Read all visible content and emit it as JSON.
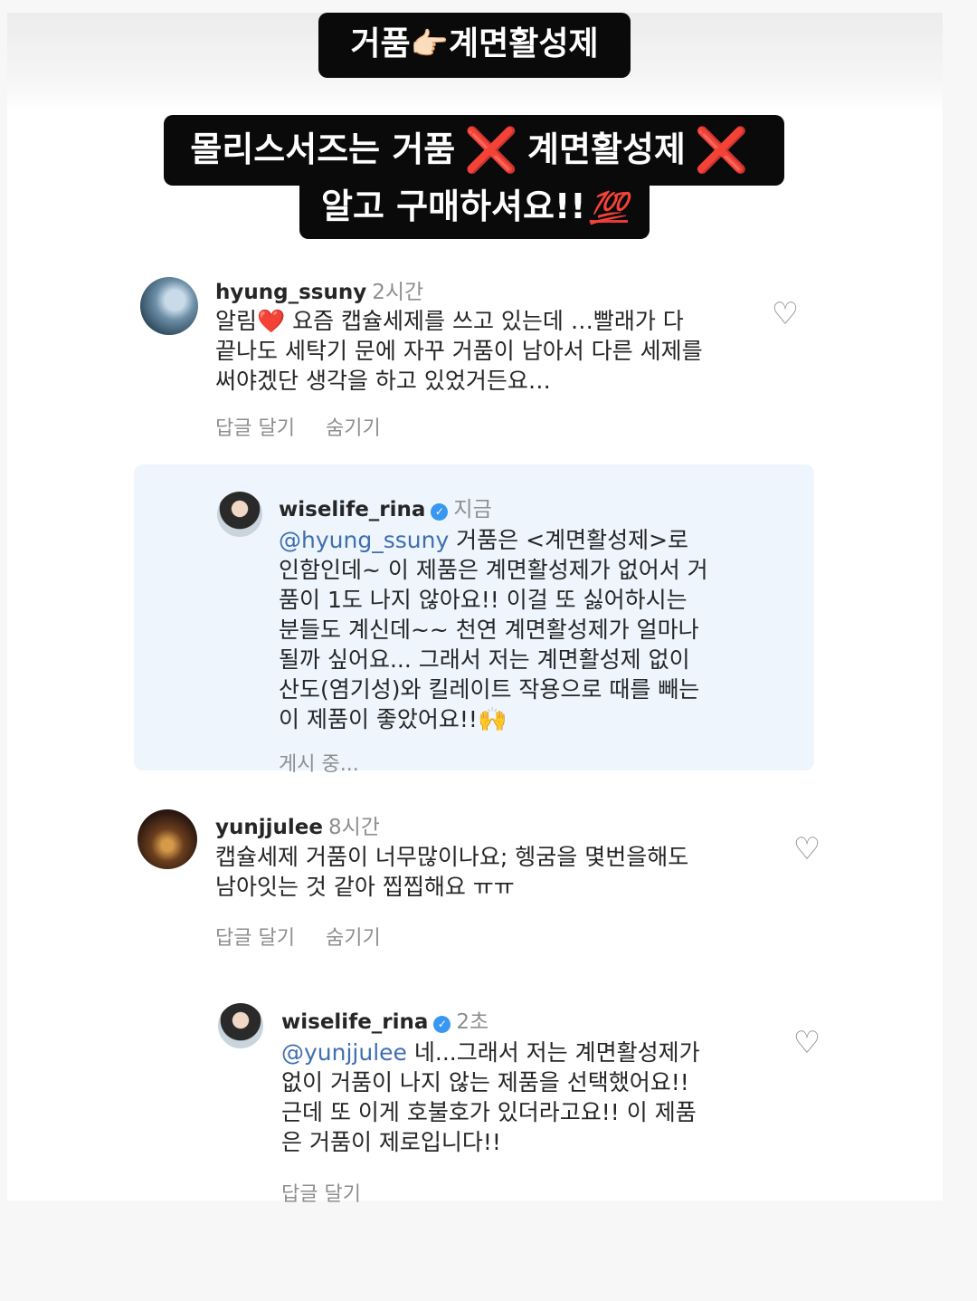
{
  "captions": {
    "line1_left": "거품",
    "line1_icon": "👉🏻",
    "line1_right": "계면활성제",
    "line2_a": "몰리스서즈는 거품",
    "line2_x": "❌",
    "line2_b": "계면활성제",
    "line3_text": "알고 구매하셔요!!",
    "line3_icon": "💯"
  },
  "comments": [
    {
      "username": "hyung_ssuny",
      "time": "2시간",
      "lines": [
        "알림❤️ 요즘 캡슐세제를 쓰고 있는데 …빨래가 다",
        "끝나도 세탁기 문에 자꾸 거품이 남아서 다른 세제를",
        "써야겠단 생각을 하고 있었거든요…"
      ],
      "actions": [
        "답글 달기",
        "숨기기"
      ],
      "heart_icon": "heart-outline-icon"
    },
    {
      "username": "wiselife_rina",
      "verified": true,
      "time": "지금",
      "mention": "@hyung_ssuny",
      "first_line_rest": " 거품은 <계면활성제>로",
      "lines": [
        "인함인데~ 이 제품은 계면활성제가 없어서 거",
        "품이 1도 나지 않아요!! 이걸 또 싫어하시는",
        "분들도 계신데~~ 천연 계면활성제가 얼마나",
        "될까 싶어요... 그래서 저는 계면활성제 없이",
        "산도(염기성)와 킬레이트 작용으로 때를 빼는",
        "이 제품이 좋았어요!!"
      ],
      "last_emoji": "🙌",
      "status": "게시 중..."
    },
    {
      "username": "yunjjulee",
      "time": "8시간",
      "lines": [
        "캡슐세제 거품이 너무많이나요; 헹굼을 몇번을해도",
        "남아잇는 것 같아 찝찝해요 ㅠㅠ"
      ],
      "actions": [
        "답글 달기",
        "숨기기"
      ],
      "heart_icon": "heart-outline-icon"
    },
    {
      "username": "wiselife_rina",
      "verified": true,
      "time": "2초",
      "mention": "@yunjjulee",
      "first_line_rest": " 네...그래서 저는 계면활성제가",
      "lines": [
        "없이 거품이 나지 않는 제품을 선택했어요!!",
        "근데 또 이게 호불호가 있더라고요!! 이 제품",
        "은 거품이 제로입니다!!"
      ],
      "actions": [
        "답글 달기"
      ],
      "heart_icon": "heart-outline-icon"
    }
  ],
  "colors": {
    "mention": "#3f6fb0",
    "caption_bg": "#0a0a0a",
    "x_mark": "#e5202b",
    "reply_panel_bg": "#eef5fd",
    "verified": "#3897f0"
  }
}
